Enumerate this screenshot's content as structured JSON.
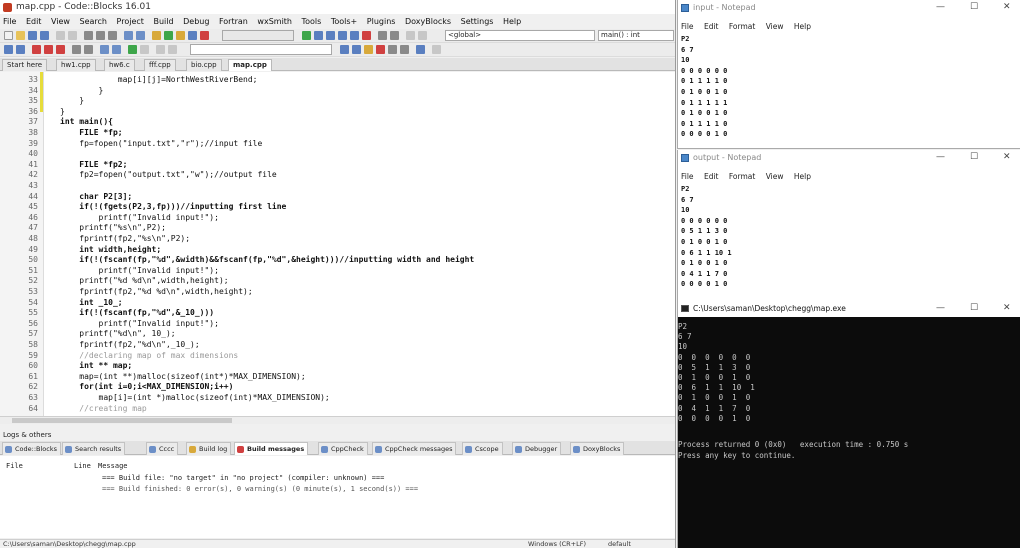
{
  "codeblocks": {
    "title": "map.cpp - Code::Blocks 16.01",
    "menu": [
      "File",
      "Edit",
      "View",
      "Search",
      "Project",
      "Build",
      "Debug",
      "Fortran",
      "wxSmith",
      "Tools",
      "Tools+",
      "Plugins",
      "DoxyBlocks",
      "Settings",
      "Help"
    ],
    "toolbar": {
      "scope_select": "<global>",
      "symbol_select": "main() : int"
    },
    "file_tabs": [
      {
        "label": "Start here",
        "active": false
      },
      {
        "label": "hw1.cpp",
        "active": false
      },
      {
        "label": "hw6.c",
        "active": false
      },
      {
        "label": "fff.cpp",
        "active": false
      },
      {
        "label": "bio.cpp",
        "active": false
      },
      {
        "label": "map.cpp",
        "active": true
      }
    ],
    "code_lines": [
      {
        "n": "33",
        "t": "            map[i][j]=NorthWestRiverBend;"
      },
      {
        "n": "34",
        "t": "        }"
      },
      {
        "n": "35",
        "t": "    }"
      },
      {
        "n": "36",
        "t": "}"
      },
      {
        "n": "37",
        "t": "int main(){"
      },
      {
        "n": "38",
        "t": "    FILE *fp;"
      },
      {
        "n": "39",
        "t": "    fp=fopen(\"input.txt\",\"r\");//input file"
      },
      {
        "n": "40",
        "t": ""
      },
      {
        "n": "41",
        "t": "    FILE *fp2;"
      },
      {
        "n": "42",
        "t": "    fp2=fopen(\"output.txt\",\"w\");//output file"
      },
      {
        "n": "43",
        "t": ""
      },
      {
        "n": "44",
        "t": "    char P2[3];"
      },
      {
        "n": "45",
        "t": "    if(!(fgets(P2,3,fp)))//inputting first line"
      },
      {
        "n": "46",
        "t": "        printf(\"Invalid input!\");"
      },
      {
        "n": "47",
        "t": "    printf(\"%s\\n\",P2);"
      },
      {
        "n": "48",
        "t": "    fprintf(fp2,\"%s\\n\",P2);"
      },
      {
        "n": "49",
        "t": "    int width,height;"
      },
      {
        "n": "50",
        "t": "    if(!(fscanf(fp,\"%d\",&width)&&fscanf(fp,\"%d\",&height)))//inputting width and height"
      },
      {
        "n": "51",
        "t": "        printf(\"Invalid input!\");"
      },
      {
        "n": "52",
        "t": "    printf(\"%d %d\\n\",width,height);"
      },
      {
        "n": "53",
        "t": "    fprintf(fp2,\"%d %d\\n\",width,height);"
      },
      {
        "n": "54",
        "t": "    int _10_;"
      },
      {
        "n": "55",
        "t": "    if(!(fscanf(fp,\"%d\",&_10_)))"
      },
      {
        "n": "56",
        "t": "        printf(\"Invalid input!\");"
      },
      {
        "n": "57",
        "t": "    printf(\"%d\\n\", 10_);"
      },
      {
        "n": "58",
        "t": "    fprintf(fp2,\"%d\\n\",_10_);"
      },
      {
        "n": "59",
        "t": "    //declaring map of max dimensions"
      },
      {
        "n": "60",
        "t": "    int ** map;"
      },
      {
        "n": "61",
        "t": "    map=(int **)malloc(sizeof(int*)*MAX_DIMENSION);"
      },
      {
        "n": "62",
        "t": "    for(int i=0;i<MAX_DIMENSION;i++)"
      },
      {
        "n": "63",
        "t": "        map[i]=(int *)malloc(sizeof(int)*MAX_DIMENSION);"
      },
      {
        "n": "64",
        "t": "    //creating map"
      }
    ],
    "logs_label": "Logs & others",
    "log_tabs": [
      {
        "label": "Code::Blocks",
        "active": false
      },
      {
        "label": "Search results",
        "active": false
      },
      {
        "label": "Cccc",
        "active": false
      },
      {
        "label": "Build log",
        "active": false
      },
      {
        "label": "Build messages",
        "active": true
      },
      {
        "label": "CppCheck",
        "active": false
      },
      {
        "label": "CppCheck messages",
        "active": false
      },
      {
        "label": "Cscope",
        "active": false
      },
      {
        "label": "Debugger",
        "active": false
      },
      {
        "label": "DoxyBlocks",
        "active": false
      }
    ],
    "log_headers": {
      "file": "File",
      "line": "Line",
      "message": "Message"
    },
    "log_messages": [
      "=== Build file: \"no target\" in \"no project\" (compiler: unknown) ===",
      "=== Build finished: 0 error(s), 0 warning(s) (0 minute(s), 1 second(s)) ==="
    ],
    "status": {
      "path": "C:\\Users\\saman\\Desktop\\chegg\\map.cpp",
      "eol": "Windows (CR+LF)",
      "encoding": "default"
    }
  },
  "notepad_input": {
    "title": "input - Notepad",
    "menu": [
      "File",
      "Edit",
      "Format",
      "View",
      "Help"
    ],
    "lines": [
      "P2",
      "6 7",
      "10",
      "0 0 0 0 0 0",
      "0 1 1 1 1 0",
      "0 1 0 0 1 0",
      "0 1 1 1 1 1",
      "0 1 0 0 1 0",
      "0 1 1 1 1 0",
      "0 0 0 0 1 0"
    ]
  },
  "notepad_output": {
    "title": "output - Notepad",
    "menu": [
      "File",
      "Edit",
      "Format",
      "View",
      "Help"
    ],
    "lines": [
      "P2",
      "6 7",
      "10",
      "0 0 0 0 0 0",
      "0 5 1 1 3 0",
      "0 1 0 0 1 0",
      "0 6 1 1 10 1",
      "0 1 0 0 1 0",
      "0 4 1 1 7 0",
      "0 0 0 0 1 0"
    ]
  },
  "console": {
    "title": "C:\\Users\\saman\\Desktop\\chegg\\map.exe",
    "lines": [
      "P2",
      "6 7",
      "10",
      "0  0  0  0  0  0",
      "0  5  1  1  3  0",
      "0  1  0  0  1  0",
      "0  6  1  1  10  1",
      "0  1  0  0  1  0",
      "0  4  1  1  7  0",
      "0  0  0  0  1  0"
    ],
    "result_line": "Process returned 0 (0x0)   execution time : 0.750 s",
    "prompt_line": "Press any key to continue."
  },
  "window_controls": {
    "minimize": "—",
    "maximize": "☐",
    "close": "✕"
  }
}
